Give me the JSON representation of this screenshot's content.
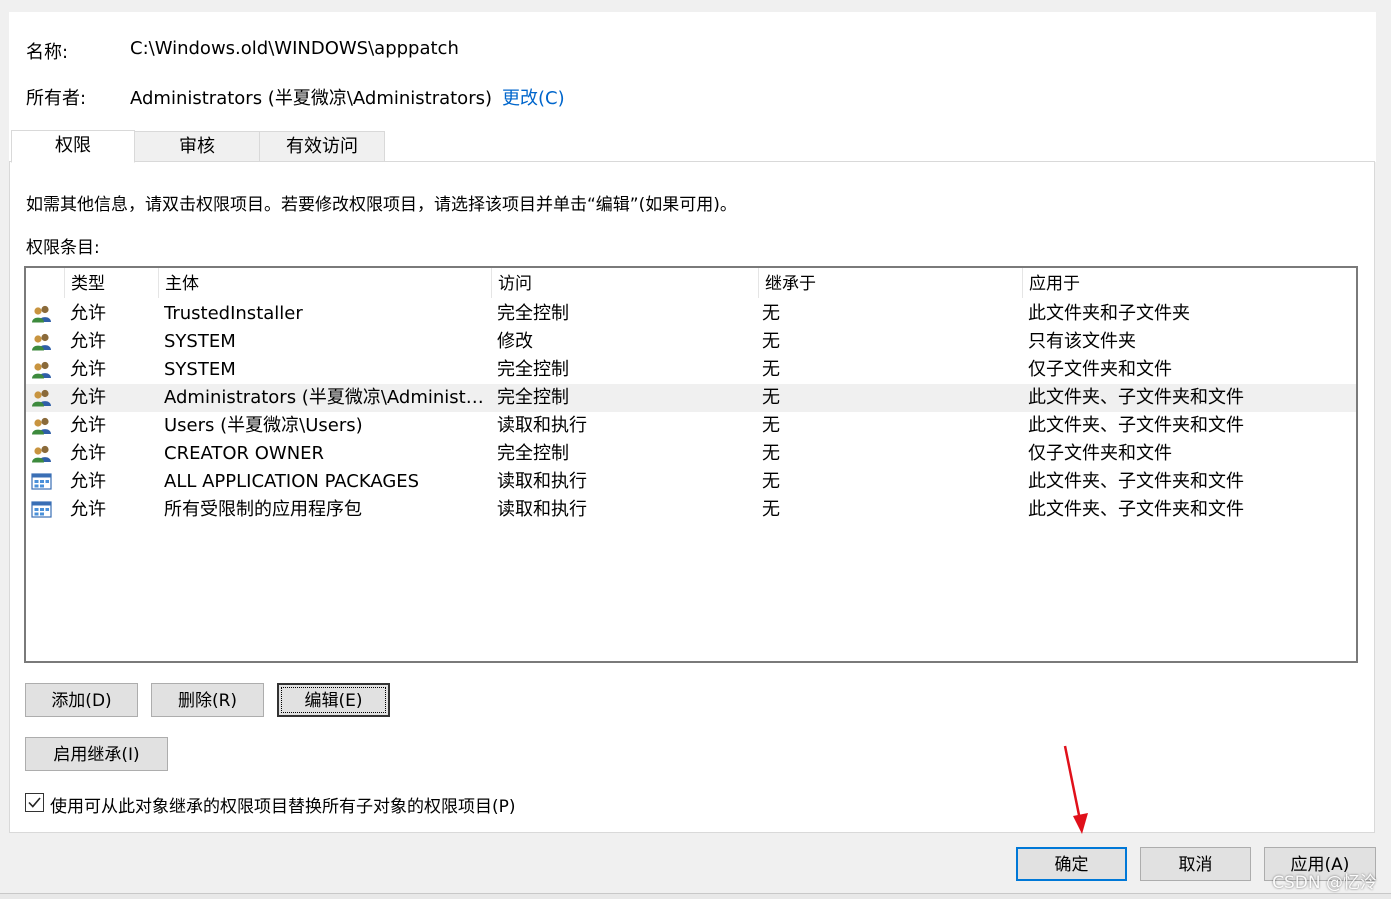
{
  "header": {
    "name_label": "名称:",
    "name_value": "C:\\Windows.old\\WINDOWS\\apppatch",
    "owner_label": "所有者:",
    "owner_value": "Administrators (半夏微凉\\Administrators)",
    "change_link": "更改(C)"
  },
  "tabs": [
    {
      "label": "权限",
      "active": true
    },
    {
      "label": "审核",
      "active": false
    },
    {
      "label": "有效访问",
      "active": false
    }
  ],
  "info_text": "如需其他信息，请双击权限项目。若要修改权限项目，请选择该项目并单击“编辑”(如果可用)。",
  "entries_label": "权限条目:",
  "table": {
    "columns": [
      "类型",
      "主体",
      "访问",
      "继承于",
      "应用于"
    ],
    "rows": [
      {
        "icon": "users-icon",
        "type": "允许",
        "principal": "TrustedInstaller",
        "access": "完全控制",
        "inherited": "无",
        "applies": "此文件夹和子文件夹"
      },
      {
        "icon": "users-icon",
        "type": "允许",
        "principal": "SYSTEM",
        "access": "修改",
        "inherited": "无",
        "applies": "只有该文件夹"
      },
      {
        "icon": "users-icon",
        "type": "允许",
        "principal": "SYSTEM",
        "access": "完全控制",
        "inherited": "无",
        "applies": "仅子文件夹和文件"
      },
      {
        "icon": "users-icon",
        "type": "允许",
        "principal": "Administrators (半夏微凉\\Administr...",
        "access": "完全控制",
        "inherited": "无",
        "applies": "此文件夹、子文件夹和文件"
      },
      {
        "icon": "users-icon",
        "type": "允许",
        "principal": "Users (半夏微凉\\Users)",
        "access": "读取和执行",
        "inherited": "无",
        "applies": "此文件夹、子文件夹和文件"
      },
      {
        "icon": "users-icon",
        "type": "允许",
        "principal": "CREATOR OWNER",
        "access": "完全控制",
        "inherited": "无",
        "applies": "仅子文件夹和文件"
      },
      {
        "icon": "app-package-icon",
        "type": "允许",
        "principal": "ALL APPLICATION PACKAGES",
        "access": "读取和执行",
        "inherited": "无",
        "applies": "此文件夹、子文件夹和文件"
      },
      {
        "icon": "app-package-icon",
        "type": "允许",
        "principal": "所有受限制的应用程序包",
        "access": "读取和执行",
        "inherited": "无",
        "applies": "此文件夹、子文件夹和文件"
      }
    ],
    "highlighted_row": 3
  },
  "buttons": {
    "add": "添加(D)",
    "remove": "删除(R)",
    "edit": "编辑(E)",
    "enable_inheritance": "启用继承(I)"
  },
  "replace_checkbox": {
    "label": "使用可从此对象继承的权限项目替换所有子对象的权限项目(P)",
    "checked": true
  },
  "footer": {
    "ok": "确定",
    "cancel": "取消",
    "apply": "应用(A)"
  },
  "watermark": "CSDN @忆泠",
  "colors": {
    "link": "#0066cc",
    "annotation_arrow": "#e0101a",
    "default_button_border": "#0078d7"
  }
}
